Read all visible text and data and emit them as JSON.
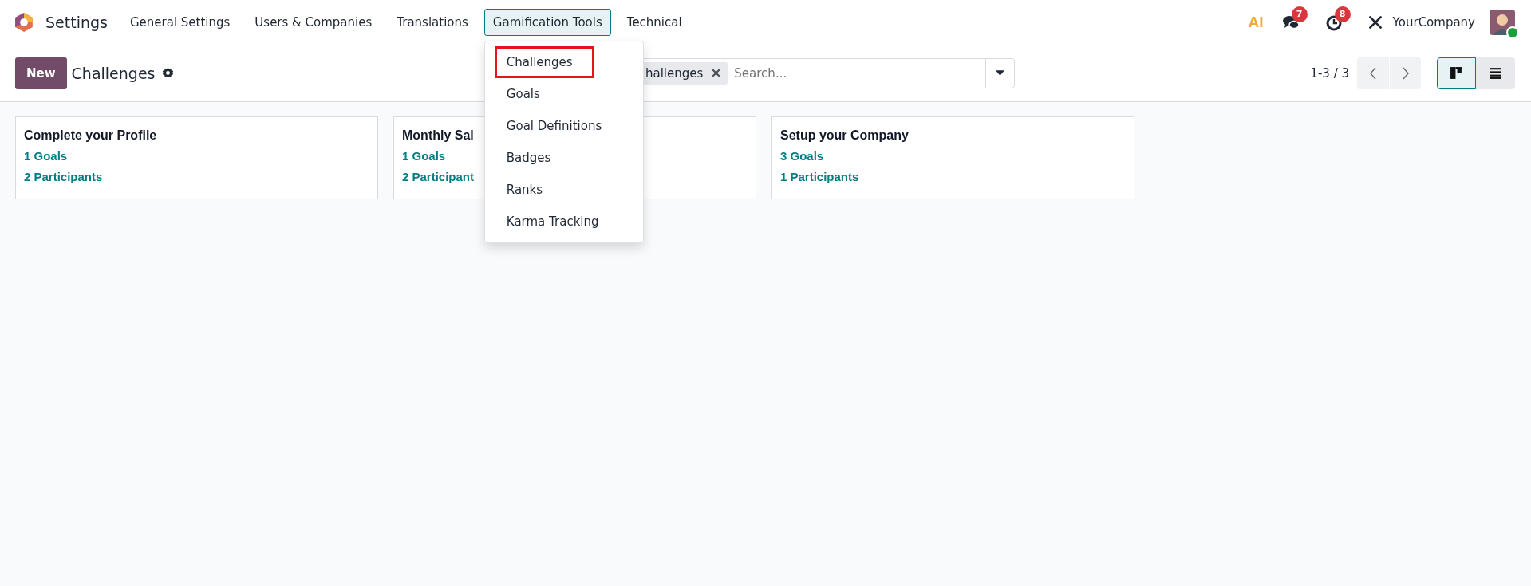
{
  "navbar": {
    "app_name": "Settings",
    "menu": [
      {
        "label": "General Settings",
        "selected": false
      },
      {
        "label": "Users & Companies",
        "selected": false
      },
      {
        "label": "Translations",
        "selected": false
      },
      {
        "label": "Gamification Tools",
        "selected": true
      },
      {
        "label": "Technical",
        "selected": false
      }
    ],
    "dropdown": [
      {
        "label": "Challenges",
        "highlighted": true
      },
      {
        "label": "Goals",
        "highlighted": false
      },
      {
        "label": "Goal Definitions",
        "highlighted": false
      },
      {
        "label": "Badges",
        "highlighted": false
      },
      {
        "label": "Ranks",
        "highlighted": false
      },
      {
        "label": "Karma Tracking",
        "highlighted": false
      }
    ],
    "ai_label": "AI",
    "messages_badge": "7",
    "activities_badge": "8",
    "company": "YourCompany",
    "user_online": true
  },
  "control_panel": {
    "new_button": "New",
    "title": "Challenges",
    "search": {
      "facet": "hallenges",
      "placeholder": "Search..."
    },
    "pager": "1-3 / 3",
    "views": [
      {
        "kind": "kanban",
        "selected": true
      },
      {
        "kind": "list",
        "selected": false
      }
    ]
  },
  "cards": [
    {
      "title": "Complete your Profile",
      "goals": "1 Goals",
      "participants": "2 Participants"
    },
    {
      "title": "Monthly Sal",
      "goals": "1 Goals",
      "participants": "2 Participant"
    },
    {
      "title": "Setup your Company",
      "goals": "3 Goals",
      "participants": "1 Participants"
    }
  ]
}
